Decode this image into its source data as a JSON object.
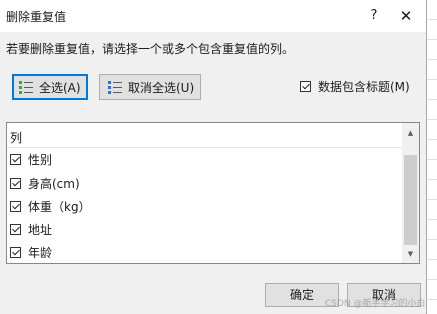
{
  "dialog": {
    "title": "删除重复值",
    "help_label": "?",
    "close_label": "✕",
    "instruction": "若要删除重复值，请选择一个或多个包含重复值的列。"
  },
  "toolbar": {
    "select_all_label": "全选(A)",
    "unselect_all_label": "取消全选(U)",
    "header_checkbox_label": "数据包含标题(M)",
    "header_checkbox_checked": true
  },
  "columns": {
    "header": "列",
    "items": [
      {
        "label": "性别",
        "checked": true
      },
      {
        "label": "身高(cm)",
        "checked": true
      },
      {
        "label": "体重（kg）",
        "checked": true
      },
      {
        "label": "地址",
        "checked": true
      },
      {
        "label": "年龄",
        "checked": true
      }
    ]
  },
  "footer": {
    "ok_label": "确定",
    "cancel_label": "取消"
  },
  "watermark": "CSDN @新手学习的小白"
}
